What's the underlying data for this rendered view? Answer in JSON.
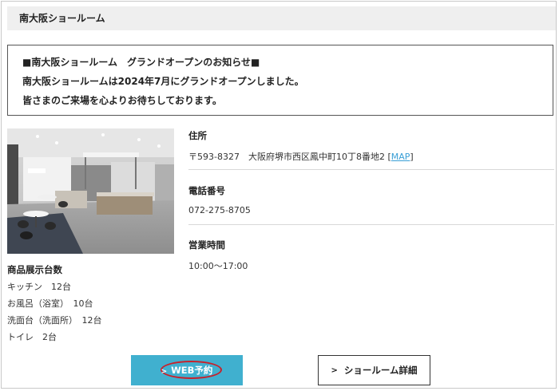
{
  "header": {
    "title": "南大阪ショールーム"
  },
  "notice": {
    "lines": [
      "■南大阪ショールーム　グランドオープンのお知らせ■",
      "南大阪ショールームは2024年7月にグランドオープンしました。",
      "皆さまのご来場を心よりお待ちしております。"
    ]
  },
  "photo": {
    "alt": "showroom-interior-photo"
  },
  "specs": {
    "title": "商品展示台数",
    "items": [
      "キッチン　12台",
      "お風呂（浴室）　10台",
      "洗面台（洗面所）　12台",
      "トイレ　2台"
    ]
  },
  "info": {
    "address_label": "住所",
    "address_value": "〒593-8327　大阪府堺市西区鳳中町10丁8番地2 [",
    "map_link": "MAP",
    "address_suffix": "]",
    "phone_label": "電話番号",
    "phone_value": "072-275-8705",
    "hours_label": "営業時間",
    "hours_value": "10:00～17:00"
  },
  "buttons": {
    "web_reserve": "WEB予約",
    "web_chevron": ">",
    "showroom_detail": "ショールーム詳細",
    "detail_chevron": ">"
  },
  "colors": {
    "web_button": "#40b0cf",
    "highlight_oval": "#c8202a",
    "link": "#3a9fd6",
    "title_bar": "#efefef"
  }
}
